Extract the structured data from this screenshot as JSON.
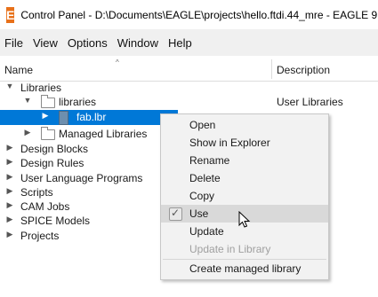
{
  "window": {
    "app_icon": "E",
    "title": "Control Panel - D:\\Documents\\EAGLE\\projects\\hello.ftdi.44_mre - EAGLE 9."
  },
  "menubar": [
    "File",
    "View",
    "Options",
    "Window",
    "Help"
  ],
  "columns": {
    "name": "Name",
    "description": "Description"
  },
  "tree": {
    "libraries": {
      "label": "Libraries",
      "arrow": "▼"
    },
    "libraries_folder": {
      "label": "libraries",
      "arrow": "▼",
      "description": "User Libraries"
    },
    "fab_lbr": {
      "label": "fab.lbr",
      "arrow": "▶"
    },
    "managed_libraries": {
      "label": "Managed Libraries",
      "arrow": "▶"
    },
    "design_blocks": {
      "label": "Design Blocks",
      "arrow": "▶"
    },
    "design_rules": {
      "label": "Design Rules",
      "arrow": "▶"
    },
    "ulps": {
      "label": "User Language Programs",
      "arrow": "▶"
    },
    "scripts": {
      "label": "Scripts",
      "arrow": "▶"
    },
    "cam_jobs": {
      "label": "CAM Jobs",
      "arrow": "▶"
    },
    "spice_models": {
      "label": "SPICE Models",
      "arrow": "▶"
    },
    "projects": {
      "label": "Projects",
      "arrow": "▶"
    }
  },
  "context_menu": {
    "open": "Open",
    "show_in_explorer": "Show in Explorer",
    "rename": "Rename",
    "delete": "Delete",
    "copy": "Copy",
    "use": "Use",
    "update": "Update",
    "update_in_library": "Update in Library",
    "create_managed_library": "Create managed library"
  },
  "colors": {
    "selection": "#0078d7",
    "app_icon": "#e8711a"
  }
}
